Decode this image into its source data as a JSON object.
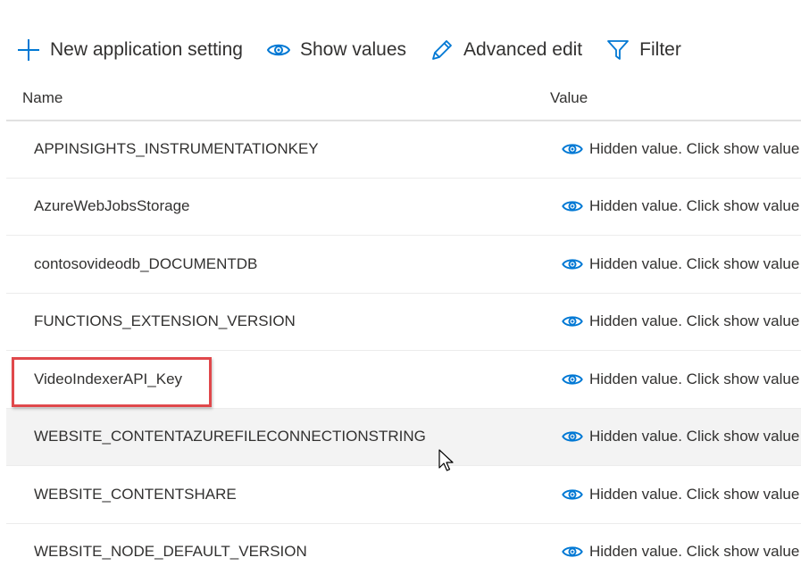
{
  "toolbar": {
    "new_setting_label": "New application setting",
    "show_values_label": "Show values",
    "advanced_edit_label": "Advanced edit",
    "filter_label": "Filter"
  },
  "table": {
    "columns": [
      "Name",
      "Value"
    ],
    "rows": [
      {
        "name": "APPINSIGHTS_INSTRUMENTATIONKEY",
        "value": "Hidden value. Click show value"
      },
      {
        "name": "AzureWebJobsStorage",
        "value": "Hidden value. Click show value"
      },
      {
        "name": "contosovideodb_DOCUMENTDB",
        "value": "Hidden value. Click show value"
      },
      {
        "name": "FUNCTIONS_EXTENSION_VERSION",
        "value": "Hidden value. Click show value"
      },
      {
        "name": "VideoIndexerAPI_Key",
        "value": "Hidden value. Click show value"
      },
      {
        "name": "WEBSITE_CONTENTAZUREFILECONNECTIONSTRING",
        "value": "Hidden value. Click show value"
      },
      {
        "name": "WEBSITE_CONTENTSHARE",
        "value": "Hidden value. Click show value"
      },
      {
        "name": "WEBSITE_NODE_DEFAULT_VERSION",
        "value": "Hidden value. Click show value"
      }
    ]
  },
  "icons": {
    "toolbar": [
      "plus-icon",
      "eye-icon",
      "pencil-icon",
      "filter-icon"
    ],
    "row_value": "eye-icon"
  },
  "colors": {
    "accent": "#0078d4",
    "highlight_border": "#e0484b",
    "hover_row": "#f3f3f3"
  }
}
